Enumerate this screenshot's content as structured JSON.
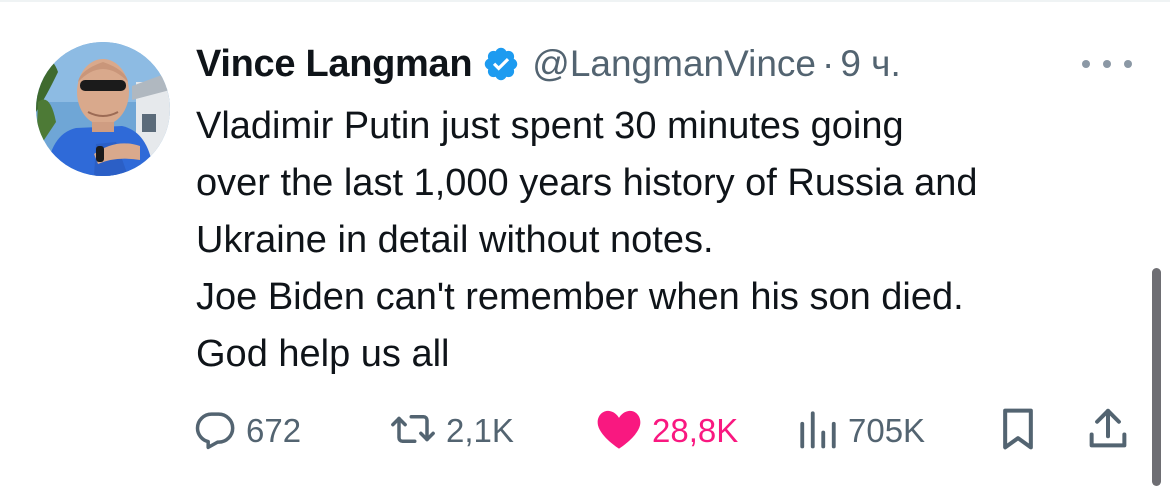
{
  "tweet": {
    "author": {
      "name": "Vince Langman",
      "handle": "@LangmanVince",
      "verified": true
    },
    "separator": "·",
    "time": "9 ч.",
    "text_lines": [
      "Vladimir Putin just spent 30 minutes going",
      "over the last 1,000 years history of Russia and",
      "Ukraine in detail without notes.",
      "Joe Biden can't remember when his son died.",
      "God help us all"
    ],
    "actions": {
      "replies": "672",
      "reposts": "2,1K",
      "likes": "28,8K",
      "views": "705K"
    }
  },
  "colors": {
    "text": "#0f1419",
    "secondary": "#536471",
    "verified": "#1d9bf0",
    "like": "#f91880"
  },
  "icons": {
    "verified": "verified-badge-icon",
    "more": "more-dots-icon",
    "reply": "reply-bubble-icon",
    "repost": "repost-arrows-icon",
    "like": "heart-icon",
    "views": "bar-chart-icon",
    "bookmark": "bookmark-icon",
    "share": "share-upload-icon"
  }
}
